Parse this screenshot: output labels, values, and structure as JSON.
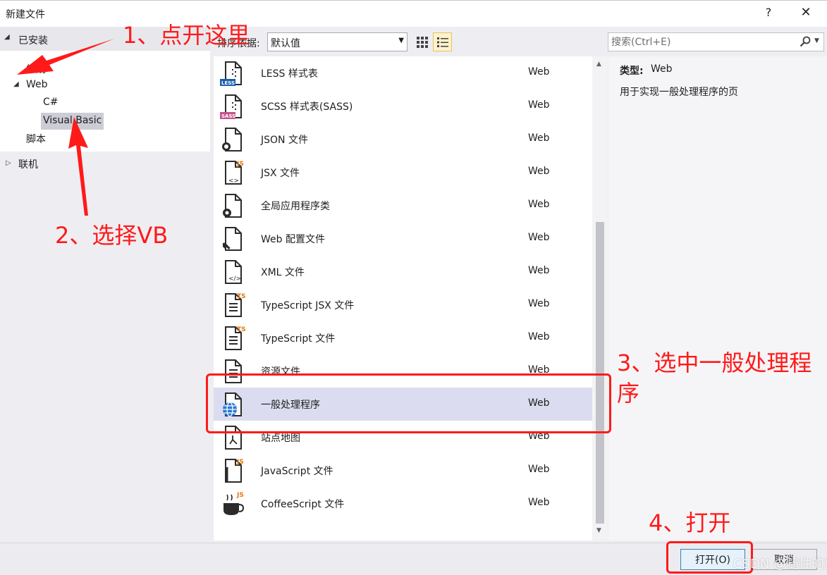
{
  "window": {
    "title": "新建文件",
    "help_glyph": "?",
    "close_glyph": "✕"
  },
  "tree": {
    "installed_label": "已安装",
    "general_label": "常规",
    "web_label": "Web",
    "csharp_label": "C#",
    "vb_label": "Visual Basic",
    "script_label": "脚本",
    "online_label": "联机"
  },
  "toolbar": {
    "sort_label": "排序依据:",
    "sort_value": "默认值",
    "search_placeholder": "搜索(Ctrl+E)",
    "active_view": "list"
  },
  "templates": [
    {
      "name": "LESS 样式表",
      "category": "Web",
      "icon": "less-icon",
      "badge": "LESS",
      "badge_color": "#1c5fb0"
    },
    {
      "name": "SCSS 样式表(SASS)",
      "category": "Web",
      "icon": "scss-icon",
      "badge": "SASS",
      "badge_color": "#c6538c"
    },
    {
      "name": "JSON 文件",
      "category": "Web",
      "icon": "json-icon"
    },
    {
      "name": "JSX 文件",
      "category": "Web",
      "icon": "jsx-icon",
      "badge": "JS",
      "badge_color": "#e8760c"
    },
    {
      "name": "全局应用程序类",
      "category": "Web",
      "icon": "global-app-class-icon"
    },
    {
      "name": "Web 配置文件",
      "category": "Web",
      "icon": "web-config-icon"
    },
    {
      "name": "XML 文件",
      "category": "Web",
      "icon": "xml-icon"
    },
    {
      "name": "TypeScript JSX 文件",
      "category": "Web",
      "icon": "typescript-jsx-icon",
      "badge": "TS",
      "badge_color": "#e8760c"
    },
    {
      "name": "TypeScript 文件",
      "category": "Web",
      "icon": "typescript-icon",
      "badge": "TS",
      "badge_color": "#e8760c"
    },
    {
      "name": "资源文件",
      "category": "Web",
      "icon": "resource-file-icon"
    },
    {
      "name": "一般处理程序",
      "category": "Web",
      "icon": "generic-handler-globe-icon",
      "selected": true
    },
    {
      "name": "站点地图",
      "category": "Web",
      "icon": "sitemap-icon"
    },
    {
      "name": "JavaScript 文件",
      "category": "Web",
      "icon": "javascript-icon",
      "badge": "JS",
      "badge_color": "#e8760c"
    },
    {
      "name": "CoffeeScript 文件",
      "category": "Web",
      "icon": "coffeescript-icon",
      "badge": "JS",
      "badge_color": "#e8760c"
    }
  ],
  "details": {
    "type_label": "类型:",
    "type_value": "Web",
    "description": "用于实现一般处理程序的页"
  },
  "buttons": {
    "open": "打开(O)",
    "cancel": "取消"
  },
  "annotations": {
    "step1": "1、点开这里",
    "step2": "2、选择VB",
    "step3_line1": "3、选中一般处理程",
    "step3_line2": "序",
    "step4": "4、打开",
    "color": "#ff1a1a"
  },
  "watermark": "CSDN @随性的豆千"
}
